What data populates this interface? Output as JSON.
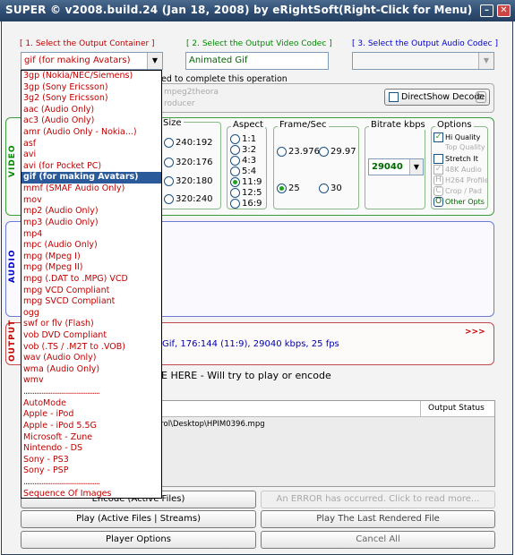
{
  "window": {
    "title": "SUPER © v2008.build.24 (Jan 18, 2008) by eRightSoft",
    "right_hint": "(Right-Click for Menu)",
    "minimize": "–",
    "close": "✕"
  },
  "headers": {
    "container": "[ 1.      Select the Output Container ]",
    "video_codec": "[ 2.   Select the Output Video Codec ]",
    "audio_codec": "[ 3.   Select the Output Audio Codec ]"
  },
  "selects": {
    "container_value": "gif  (for making Avatars)",
    "video_codec_value": "Animated Gif",
    "audio_codec_value": ""
  },
  "info": {
    "line1": "ed to complete this operation",
    "line2": "mpeg2theora",
    "line3": "roducer",
    "directshow_label": "DirectShow Decode",
    "directshow_letter": "D"
  },
  "video": {
    "side_label": "VIDEO",
    "size_title": "Size",
    "sizes": [
      "240:192",
      "320:176",
      "320:180",
      "320:240"
    ],
    "aspect_title": "Aspect",
    "aspects": [
      "1:1",
      "3:2",
      "4:3",
      "5:4",
      "11:9",
      "12:5",
      "16:9"
    ],
    "aspect_selected": "11:9",
    "fps_title": "Frame/Sec",
    "fps": [
      "23.976",
      "29.97",
      "25",
      "30"
    ],
    "fps_selected": "25",
    "bitrate_title": "Bitrate  kbps",
    "bitrate_value": "29040",
    "options_title": "Options",
    "options": {
      "hi_quality": "Hi Quality",
      "top_quality": "Top Quality",
      "stretch_it": "Stretch It",
      "k48_audio": "48K Audio",
      "h264_profile": "H264 Profile",
      "crop_pad": "Crop / Pad",
      "other_opts": "Other Opts",
      "h264_letter": "H",
      "crop_letter": "C",
      "other_letter": "O"
    }
  },
  "audio": {
    "side_label": "AUDIO"
  },
  "output": {
    "side_label": "OUTPUT",
    "summary": "Gif,  176:144 (11:9),  29040 kbps,  25 fps",
    "arrows": ">>>"
  },
  "drop_hint": "E HERE - Will try to play or encode",
  "file_table": {
    "column_output_status": "Output Status",
    "row_path": "arol\\Desktop\\HPIM0396.mpg"
  },
  "buttons": {
    "encode": "Encode (Active Files)",
    "error": "An ERROR has occurred. Click to read more...",
    "play_active": "Play (Active Files | Streams)",
    "play_last": "Play The Last Rendered File",
    "player_options": "Player Options",
    "cancel_all": "Cancel All"
  },
  "container_options": [
    "3gp  (Nokia/NEC/Siemens)",
    "3gp  (Sony Ericsson)",
    "3g2  (Sony Ericsson)",
    "aac  (Audio Only)",
    "ac3  (Audio Only)",
    "amr  (Audio Only - Nokia...)",
    "asf",
    "avi",
    "avi  (for Pocket PC)",
    "gif  (for making Avatars)",
    "mmf  (SMAF Audio Only)",
    "mov",
    "mp2  (Audio Only)",
    "mp3  (Audio Only)",
    "mp4",
    "mpc  (Audio Only)",
    "mpg  (Mpeg I)",
    "mpg  (Mpeg II)",
    "mpg  (.DAT to .MPG) VCD",
    "mpg  VCD Compliant",
    "mpg  SVCD Compliant",
    "ogg",
    "swf or flv (Flash)",
    "vob  DVD Compliant",
    "vob  (.TS / .M2T to .VOB)",
    "wav (Audio Only)",
    "wma (Audio Only)",
    "wmv",
    "..........................................",
    "AutoMode",
    "Apple - iPod",
    "Apple - iPod 5.5G",
    "Microsoft - Zune",
    "Nintendo - DS",
    "Sony - PS3",
    "Sony - PSP",
    "..........................................",
    "Sequence Of Images"
  ],
  "container_selected_index": 9,
  "colors": {
    "titlebar": "#2f4d72",
    "header_red": "#c00000",
    "header_green": "#008800",
    "header_blue": "#0000cc",
    "selected_item": "#2a5a9a"
  }
}
